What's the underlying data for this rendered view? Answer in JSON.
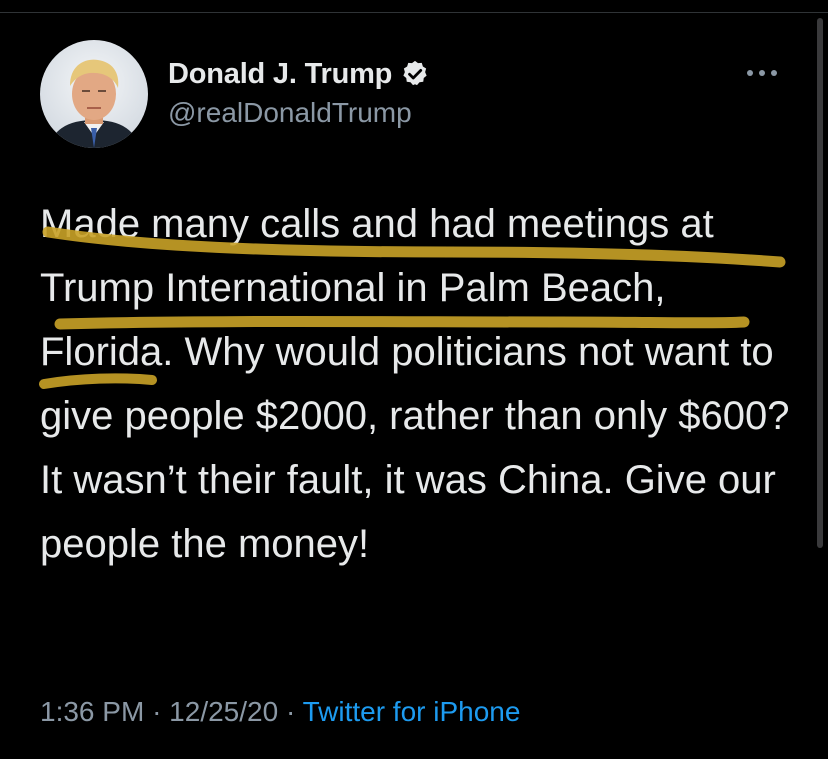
{
  "tweet": {
    "author": {
      "display_name": "Donald J. Trump",
      "handle": "@realDonaldTrump",
      "verified": true,
      "avatar_icon": "profile-photo-icon",
      "verified_icon": "verified-badge-icon"
    },
    "more_icon": "more-options-icon",
    "text": "Made many calls and had meetings at Trump International in Palm Beach, Florida. Why would politicians not want to give people $2000, rather than only $600? It wasn’t their fault, it was China. Give our people the money!",
    "time": "1:36 PM",
    "separator": "·",
    "date": "12/25/20",
    "source": "Twitter for iPhone"
  },
  "colors": {
    "background": "#000000",
    "text": "#e7e9ea",
    "secondary_text": "#8b98a5",
    "link": "#1d9bf0",
    "verified_badge": "#e7e9ea",
    "highlight_marker": "#c9a227"
  }
}
